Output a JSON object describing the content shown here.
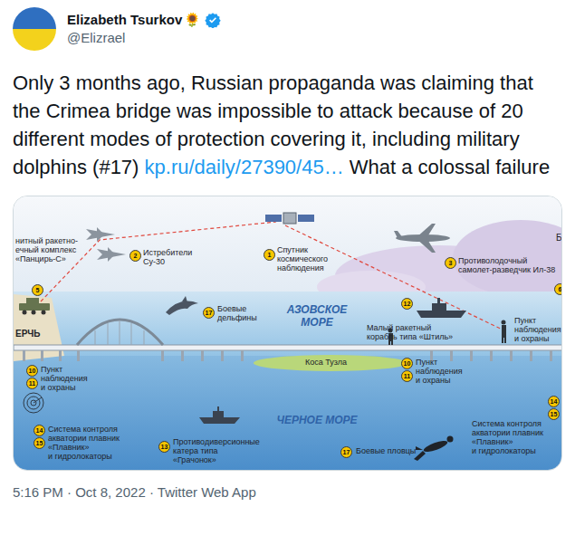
{
  "author": {
    "name": "Elizabeth Tsurkov",
    "emoji": "🌻",
    "verified": true,
    "handle": "@Elizrael"
  },
  "tweet": {
    "parts": [
      {
        "kind": "text",
        "text": "Only 3 months ago, Russian propaganda was claiming that the Crimea bridge was impossible to attack because of 20 different modes of protection covering it, including military dolphins (#17) "
      },
      {
        "kind": "link",
        "text": "kp.ru/daily/27390/45…"
      },
      {
        "kind": "text",
        "text": " What a colossal failure"
      }
    ]
  },
  "diagram": {
    "seas": [
      {
        "lines": [
          "АЗОВСКОЕ",
          "МОРЕ"
        ]
      },
      {
        "lines": [
          "ЧЕРНОЕ МОРЕ"
        ]
      }
    ],
    "places": [
      "ЕРЧЬ",
      "Коса Тузла"
    ],
    "edge_fragments": [
      "Б"
    ],
    "markers": [
      {
        "numbers": [],
        "lines": [
          "нитный ракетно-",
          "ечный комплекс",
          "«Панцирь-С»"
        ]
      },
      {
        "numbers": [
          "5"
        ],
        "lines": []
      },
      {
        "numbers": [
          "2"
        ],
        "lines": [
          "Истребители",
          "Су-30"
        ]
      },
      {
        "numbers": [
          "1"
        ],
        "lines": [
          "Спутник",
          "космического",
          "наблюдения"
        ]
      },
      {
        "numbers": [
          "3"
        ],
        "lines": [
          "Противолодочный",
          "самолет-разведчик Ил-38"
        ]
      },
      {
        "numbers": [
          "6"
        ],
        "lines": []
      },
      {
        "numbers": [
          "17"
        ],
        "lines": [
          "Боевые",
          "дельфины"
        ]
      },
      {
        "numbers": [
          "12"
        ],
        "lines": [
          "Малый ракетный",
          "корабль типа «Штиль»"
        ]
      },
      {
        "numbers": [],
        "lines": [
          "Пункт",
          "наблюдения",
          "и охраны"
        ]
      },
      {
        "numbers": [
          "10",
          "11"
        ],
        "lines": [
          "Пункт",
          "наблюдения",
          "и охраны"
        ]
      },
      {
        "numbers": [
          "10",
          "11"
        ],
        "lines": [
          "Пункт",
          "наблюдения",
          "и охраны"
        ]
      },
      {
        "numbers": [
          "14",
          "15"
        ],
        "lines": [
          "Система контроля",
          "акватории плавник",
          "«Плавник»",
          "и гидролокаторы"
        ]
      },
      {
        "numbers": [
          "13"
        ],
        "lines": [
          "Противодиверсионные",
          "катера типа",
          "«Грачонок»"
        ]
      },
      {
        "numbers": [
          "17"
        ],
        "lines": [
          "Боевые пловцы"
        ]
      },
      {
        "numbers": [
          "14",
          "15"
        ],
        "lines": [
          "Система контроля",
          "акватории плавник",
          "«Плавник»",
          "и гидролокаторы"
        ]
      }
    ]
  },
  "timestamp": "5:16 PM · Oct 8, 2022 · Twitter Web App"
}
